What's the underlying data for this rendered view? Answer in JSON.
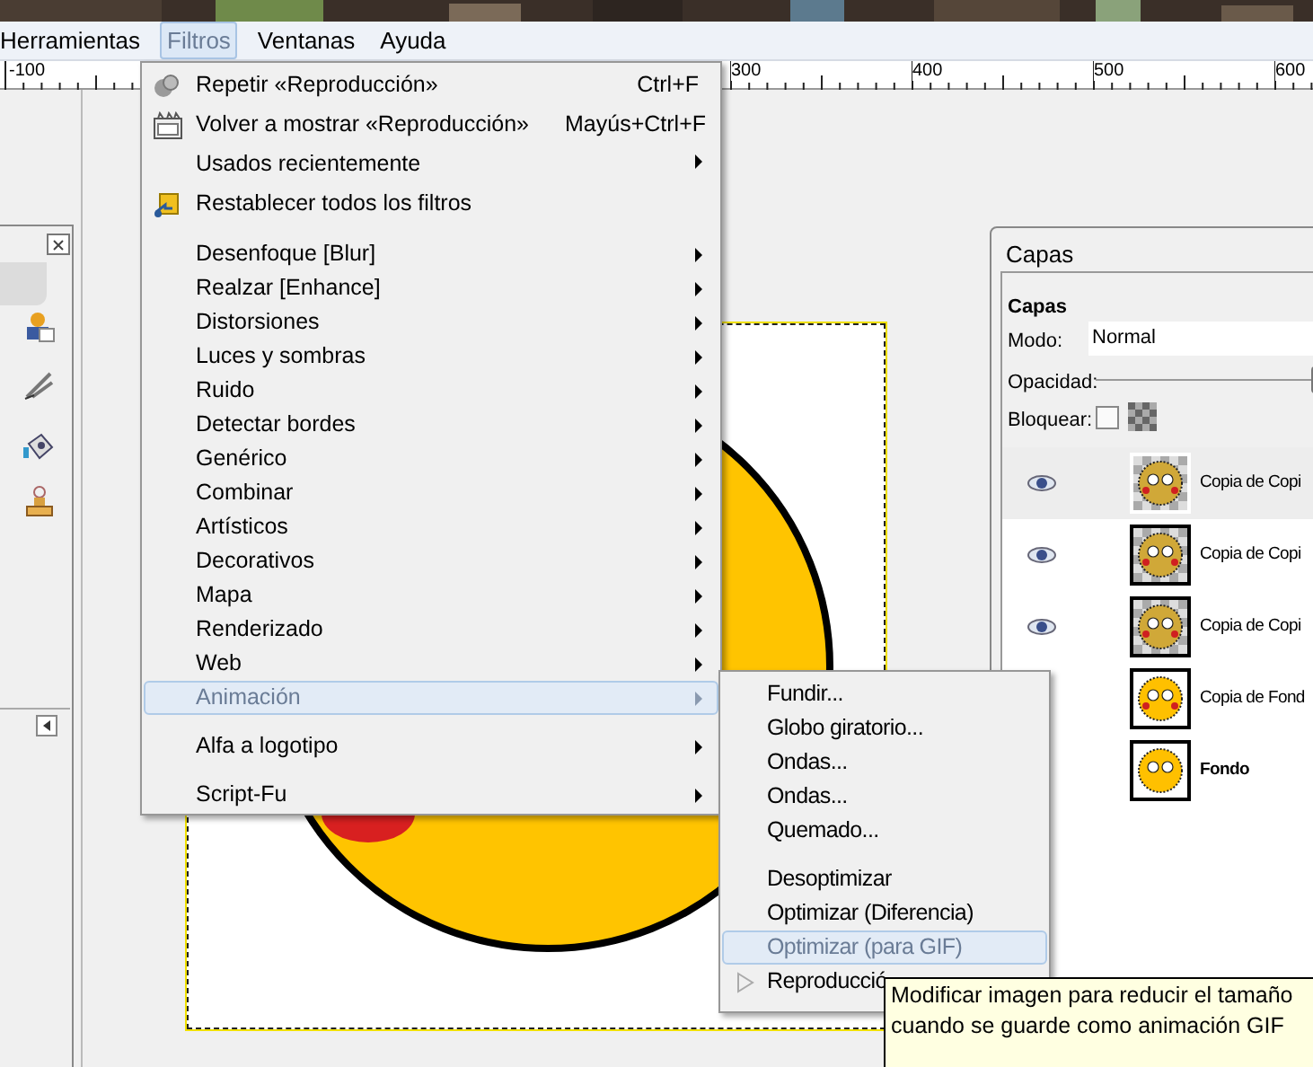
{
  "menubar": [
    {
      "label": "Herramientas",
      "selected": false
    },
    {
      "label": "Filtros",
      "selected": true
    },
    {
      "label": "Ventanas",
      "selected": false
    },
    {
      "label": "Ayuda",
      "selected": false
    }
  ],
  "ruler": {
    "labels": [
      "-100",
      "300",
      "400",
      "500",
      "600"
    ]
  },
  "filters_menu": {
    "sections": [
      [
        {
          "label": "Repetir «Reproducción»",
          "shortcut": "Ctrl+F",
          "submenu": false,
          "selected": false
        },
        {
          "label": "Volver a mostrar «Reproducción»",
          "shortcut": "Mayús+Ctrl+F",
          "submenu": false,
          "selected": false
        },
        {
          "label": "Usados recientemente",
          "submenu": true,
          "selected": false
        },
        {
          "label": "Restablecer todos los filtros",
          "submenu": false,
          "selected": false
        }
      ],
      [
        {
          "label": "Desenfoque [Blur]",
          "submenu": true,
          "selected": false
        },
        {
          "label": "Realzar [Enhance]",
          "submenu": true,
          "selected": false
        },
        {
          "label": "Distorsiones",
          "submenu": true,
          "selected": false
        },
        {
          "label": "Luces y sombras",
          "submenu": true,
          "selected": false
        },
        {
          "label": "Ruido",
          "submenu": true,
          "selected": false
        },
        {
          "label": "Detectar bordes",
          "submenu": true,
          "selected": false
        },
        {
          "label": "Genérico",
          "submenu": true,
          "selected": false
        },
        {
          "label": "Combinar",
          "submenu": true,
          "selected": false
        },
        {
          "label": "Artísticos",
          "submenu": true,
          "selected": false
        },
        {
          "label": "Decorativos",
          "submenu": true,
          "selected": false
        },
        {
          "label": "Mapa",
          "submenu": true,
          "selected": false
        },
        {
          "label": "Renderizado",
          "submenu": true,
          "selected": false
        },
        {
          "label": "Web",
          "submenu": true,
          "selected": false
        },
        {
          "label": "Animación",
          "submenu": true,
          "selected": true
        }
      ],
      [
        {
          "label": "Alfa a logotipo",
          "submenu": true,
          "selected": false
        }
      ],
      [
        {
          "label": "Script-Fu",
          "submenu": true,
          "selected": false
        }
      ]
    ]
  },
  "animation_menu": {
    "sections": [
      [
        {
          "label": "Fundir...",
          "selected": false
        },
        {
          "label": "Globo giratorio...",
          "selected": false
        },
        {
          "label": "Ondas...",
          "selected": false
        },
        {
          "label": "Ondas...",
          "selected": false
        },
        {
          "label": "Quemado...",
          "selected": false
        }
      ],
      [
        {
          "label": "Desoptimizar",
          "selected": false
        },
        {
          "label": "Optimizar (Diferencia)",
          "selected": false
        },
        {
          "label": "Optimizar (para GIF)",
          "selected": true
        },
        {
          "label": "Reproducció",
          "selected": false
        }
      ]
    ]
  },
  "tooltip": {
    "text": "Modificar imagen para reducir el tamaño cuando se guarde como animación GIF"
  },
  "layers_dialog": {
    "title": "Capas",
    "heading": "Capas",
    "mode_label": "Modo:",
    "mode_value": "Normal",
    "opacity_label": "Opacidad:",
    "opacity": {
      "level": 1
    },
    "lock_label": "Bloquear:",
    "lock_checked": false,
    "layers": [
      {
        "name": "Copia de Copi",
        "visible": true,
        "selected": true,
        "transparent": true,
        "bold": false
      },
      {
        "name": "Copia de Copi",
        "visible": true,
        "selected": false,
        "transparent": true,
        "bold": false
      },
      {
        "name": "Copia de Copi",
        "visible": true,
        "selected": false,
        "transparent": true,
        "bold": false
      },
      {
        "name": "Copia de Fond",
        "selected": false,
        "transparent": false,
        "bold": false
      },
      {
        "name": "Fondo",
        "selected": false,
        "transparent": false,
        "bold": true
      }
    ]
  }
}
